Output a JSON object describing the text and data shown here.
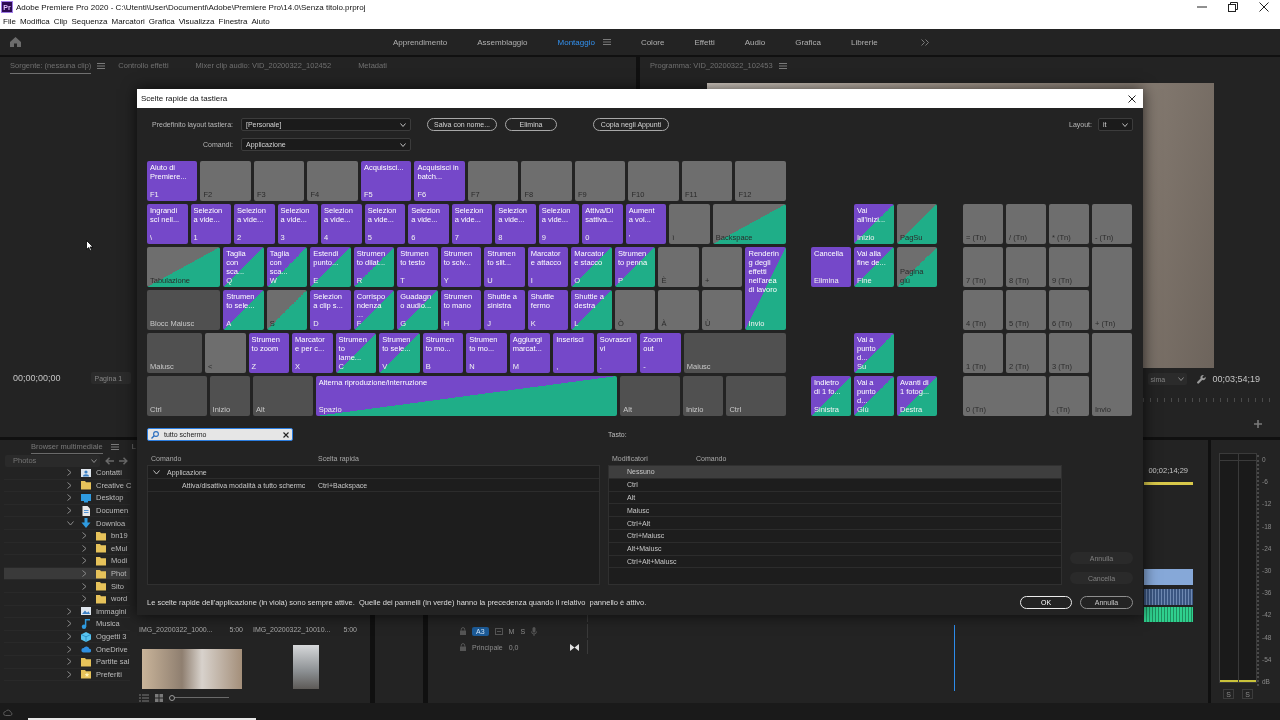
{
  "window": {
    "app_icon": "Pr",
    "title": "Adobe Premiere Pro 2020 - C:\\Utenti\\User\\Documenti\\Adobe\\Premiere Pro\\14.0\\Senza titolo.prproj"
  },
  "menu": [
    "File",
    "Modifica",
    "Clip",
    "Sequenza",
    "Marcatori",
    "Grafica",
    "Visualizza",
    "Finestra",
    "Aiuto"
  ],
  "workspaces": [
    {
      "label": "Apprendimento",
      "selected": false
    },
    {
      "label": "Assemblaggio",
      "selected": false
    },
    {
      "label": "Montaggio",
      "selected": true
    },
    {
      "label": "Colore",
      "selected": false
    },
    {
      "label": "Effetti",
      "selected": false
    },
    {
      "label": "Audio",
      "selected": false
    },
    {
      "label": "Grafica",
      "selected": false
    },
    {
      "label": "Librerie",
      "selected": false
    }
  ],
  "source_panel": {
    "tabs": [
      {
        "label": "Sorgente: (nessuna clip)",
        "selected": true
      },
      {
        "label": "Controllo effetti",
        "selected": false
      },
      {
        "label": "Mixer clip audio: VID_20200322_102452",
        "selected": false
      },
      {
        "label": "Metadati",
        "selected": false
      }
    ],
    "timecode": "00;00;00;00",
    "page": "Pagina 1"
  },
  "program_panel": {
    "tabs": [
      {
        "label": "Programma: VID_20200322_102453",
        "selected": false
      }
    ],
    "resolution": "sima",
    "timecode": "00;03;54;19"
  },
  "media_browser": {
    "tabs": [
      {
        "label": "Browser multimediale",
        "selected": true
      },
      {
        "label": "L",
        "selected": false
      }
    ],
    "location": "Photos",
    "tree": [
      {
        "label": "Contatti",
        "kind": "contacts",
        "expanded": false,
        "selected": false
      },
      {
        "label": "Creative C",
        "kind": "folder",
        "expanded": false,
        "selected": false
      },
      {
        "label": "Desktop",
        "kind": "desktop",
        "expanded": false,
        "selected": false
      },
      {
        "label": "Documen",
        "kind": "document",
        "expanded": false,
        "selected": false
      },
      {
        "label": "Downloa",
        "kind": "download",
        "expanded": true,
        "selected": false,
        "children": [
          {
            "label": "bn19",
            "kind": "folder",
            "expanded": false,
            "selected": false
          },
          {
            "label": "eMul",
            "kind": "folder",
            "expanded": false,
            "selected": false
          },
          {
            "label": "Modi",
            "kind": "folder",
            "expanded": false,
            "selected": false
          },
          {
            "label": "Phot",
            "kind": "folder",
            "expanded": false,
            "selected": true
          },
          {
            "label": "Sito",
            "kind": "folder",
            "expanded": false,
            "selected": false
          },
          {
            "label": "word",
            "kind": "folder",
            "expanded": false,
            "selected": false
          }
        ]
      },
      {
        "label": "Immagini",
        "kind": "images",
        "expanded": false,
        "selected": false
      },
      {
        "label": "Musica",
        "kind": "music",
        "expanded": false,
        "selected": false
      },
      {
        "label": "Oggetti 3",
        "kind": "objects",
        "expanded": false,
        "selected": false
      },
      {
        "label": "OneDrive",
        "kind": "cloud",
        "expanded": false,
        "selected": false
      },
      {
        "label": "Partite sal",
        "kind": "folder",
        "expanded": false,
        "selected": false
      },
      {
        "label": "Preferiti",
        "kind": "favorites",
        "expanded": false,
        "selected": false
      }
    ],
    "thumbnails": [
      {
        "name": "IMG_20200322_1000...",
        "duration": "5:00"
      },
      {
        "name": "IMG_20200322_10010...",
        "duration": "5:00"
      }
    ],
    "thumbnail_zoom": {
      "level": 0
    }
  },
  "timeline": {
    "ruler_timecode": "00;02;14;29",
    "track_target": "A3",
    "mute": "M",
    "solo": "S",
    "mix_track": "Principale",
    "mix_volume": "0,0"
  },
  "audio_meter": {
    "scale": [
      "0",
      "-6",
      "-12",
      "-18",
      "-24",
      "-30",
      "-36",
      "-42",
      "-48",
      "-54",
      "dB"
    ],
    "solo_buttons": [
      "S",
      "S"
    ]
  },
  "dialog": {
    "title": "Scelte rapide da tastiera",
    "preset": {
      "label": "Predefinito layout tastiera:",
      "value": "[Personale]"
    },
    "preset_buttons": [
      "Salva con nome...",
      "Elimina",
      "Copia negli Appunti"
    ],
    "layout": {
      "label": "Layout:",
      "value": "it"
    },
    "commands": {
      "label": "Comandi:",
      "value": "Applicazione"
    },
    "keyboard": {
      "main_keys": [
        {
          "key": "F1",
          "command": "Aiuto di\nPremiere...",
          "kind": "app"
        },
        {
          "key": "F2",
          "kind": "free"
        },
        {
          "key": "F3",
          "kind": "free"
        },
        {
          "key": "F4",
          "kind": "free"
        },
        {
          "key": "F5",
          "command": "Acquisisci...",
          "kind": "app"
        },
        {
          "key": "F6",
          "command": "Acquisisci in\nbatch...",
          "kind": "app"
        },
        {
          "key": "F7",
          "kind": "free"
        },
        {
          "key": "F8",
          "kind": "free"
        },
        {
          "key": "F9",
          "kind": "free"
        },
        {
          "key": "F10",
          "kind": "free"
        },
        {
          "key": "F11",
          "kind": "free"
        },
        {
          "key": "F12",
          "kind": "free"
        },
        {
          "key": "\\",
          "command": "Ingrandi\nsci nell...",
          "kind": "app"
        },
        {
          "key": "1",
          "command": "Selezion\na vide...",
          "kind": "app"
        },
        {
          "key": "2",
          "command": "Selezion\na vide...",
          "kind": "app"
        },
        {
          "key": "3",
          "command": "Selezion\na vide...",
          "kind": "app"
        },
        {
          "key": "4",
          "command": "Selezion\na vide...",
          "kind": "app"
        },
        {
          "key": "5",
          "command": "Selezion\na vide...",
          "kind": "app"
        },
        {
          "key": "6",
          "command": "Selezion\na vide...",
          "kind": "app"
        },
        {
          "key": "7",
          "command": "Selezion\na vide...",
          "kind": "app"
        },
        {
          "key": "8",
          "command": "Selezion\na vide...",
          "kind": "app"
        },
        {
          "key": "9",
          "command": "Selezion\na vide...",
          "kind": "app"
        },
        {
          "key": "0",
          "command": "Attiva/Di\nsattiva...",
          "kind": "app"
        },
        {
          "key": "'",
          "command": "Aument\na vol...",
          "kind": "app"
        },
        {
          "key": "ì",
          "kind": "free"
        },
        {
          "key": "Backspace",
          "kind": "panel"
        },
        {
          "key": "Tabulazione",
          "kind": "panel"
        },
        {
          "key": "Q",
          "command": "Taglia\ncon\nsca...",
          "kind": "both"
        },
        {
          "key": "W",
          "command": "Taglia\ncon\nsca...",
          "kind": "both"
        },
        {
          "key": "E",
          "command": "Estendi\npunto...",
          "kind": "both"
        },
        {
          "key": "R",
          "command": "Strumen\nto dilat...",
          "kind": "both"
        },
        {
          "key": "T",
          "command": "Strumen\nto testo",
          "kind": "app"
        },
        {
          "key": "Y",
          "command": "Strumen\nto sciv...",
          "kind": "app"
        },
        {
          "key": "U",
          "command": "Strumen\nto slit...",
          "kind": "app"
        },
        {
          "key": "I",
          "command": "Marcator\ne attacco",
          "kind": "app"
        },
        {
          "key": "O",
          "command": "Marcator\ne stacco",
          "kind": "both"
        },
        {
          "key": "P",
          "command": "Strumen\nto penna",
          "kind": "both"
        },
        {
          "key": "È",
          "kind": "free"
        },
        {
          "key": "+",
          "kind": "free"
        },
        {
          "key": "Blocc Maiusc",
          "kind": "modifier"
        },
        {
          "key": "A",
          "command": "Strumen\nto sele...",
          "kind": "both"
        },
        {
          "key": "S",
          "kind": "panel"
        },
        {
          "key": "D",
          "command": "Selezion\na clip s...",
          "kind": "app"
        },
        {
          "key": "F",
          "command": "Corrispo\nndenza\n...",
          "kind": "both"
        },
        {
          "key": "G",
          "command": "Guadagn\no audio...",
          "kind": "both"
        },
        {
          "key": "H",
          "command": "Strumen\nto mano",
          "kind": "app"
        },
        {
          "key": "J",
          "command": "Shuttle a\nsinistra",
          "kind": "app"
        },
        {
          "key": "K",
          "command": "Shuttle\nfermo",
          "kind": "app"
        },
        {
          "key": "L",
          "command": "Shuttle a\ndestra",
          "kind": "both"
        },
        {
          "key": "Ò",
          "kind": "free"
        },
        {
          "key": "À",
          "kind": "free"
        },
        {
          "key": "Ù",
          "kind": "free"
        },
        {
          "key": "Invio",
          "command": "Renderin\ng degli\neffetti\nnell'area\ndi lavoro",
          "kind": "both"
        },
        {
          "key": "Maiusc",
          "kind": "modifier"
        },
        {
          "key": "<",
          "kind": "free"
        },
        {
          "key": "Z",
          "command": "Strumen\nto zoom",
          "kind": "app"
        },
        {
          "key": "X",
          "command": "Marcator\ne per c...",
          "kind": "app"
        },
        {
          "key": "C",
          "command": "Strumen\nto\nlame...",
          "kind": "both"
        },
        {
          "key": "V",
          "command": "Strumen\nto sele...",
          "kind": "both"
        },
        {
          "key": "B",
          "command": "Strumen\nto mo...",
          "kind": "app"
        },
        {
          "key": "N",
          "command": "Strumen\nto mo...",
          "kind": "app"
        },
        {
          "key": "M",
          "command": "Aggiungi\nmarcat...",
          "kind": "app"
        },
        {
          "key": ",",
          "command": "Inserisci",
          "kind": "app"
        },
        {
          "key": ".",
          "command": "Sovrascri\nvi",
          "kind": "app"
        },
        {
          "key": "-",
          "command": "Zoom\nout",
          "kind": "app"
        },
        {
          "key": "Maiusc",
          "kind": "modifier"
        },
        {
          "key": "Ctrl",
          "kind": "modifier"
        },
        {
          "key": "Inizio",
          "kind": "modifier"
        },
        {
          "key": "Alt",
          "kind": "modifier"
        },
        {
          "key": "Spazio",
          "command": "Alterna riproduzione/interruzione",
          "kind": "both"
        },
        {
          "key": "Alt",
          "kind": "modifier"
        },
        {
          "key": "Inizio",
          "kind": "modifier"
        },
        {
          "key": "Ctrl",
          "kind": "modifier"
        }
      ],
      "nav": [
        {
          "key": "Inizio",
          "command": "Vai\nall'inizi...",
          "kind": "both"
        },
        {
          "key": "PagSu",
          "kind": "panel"
        },
        {
          "key": "Elimina",
          "command": "Cancella",
          "kind": "app"
        },
        {
          "key": "Fine",
          "command": "Vai alla\nfine de...",
          "kind": "both"
        },
        {
          "key": "Pagina\ngiù",
          "kind": "panel"
        },
        {
          "key": "Su",
          "command": "Vai a\npunto\nd...",
          "kind": "both"
        },
        {
          "key": "Sinistra",
          "command": "Indietro\ndi 1 fo...",
          "kind": "both"
        },
        {
          "key": "Giù",
          "command": "Vai a\npunto\nd...",
          "kind": "both"
        },
        {
          "key": "Destra",
          "command": "Avanti di\n1 fotog...",
          "kind": "both"
        }
      ],
      "numpad": [
        {
          "key": "= (Tn)",
          "kind": "free"
        },
        {
          "key": "/ (Tn)",
          "kind": "free"
        },
        {
          "key": "* (Tn)",
          "kind": "free"
        },
        {
          "key": "- (Tn)",
          "kind": "free"
        },
        {
          "key": "7 (Tn)",
          "kind": "free"
        },
        {
          "key": "8 (Tn)",
          "kind": "free"
        },
        {
          "key": "9 (Tn)",
          "kind": "free"
        },
        {
          "key": "4 (Tn)",
          "kind": "free"
        },
        {
          "key": "5 (Tn)",
          "kind": "free"
        },
        {
          "key": "6 (Tn)",
          "kind": "free"
        },
        {
          "key": "+ (Tn)",
          "kind": "free"
        },
        {
          "key": "1 (Tn)",
          "kind": "free"
        },
        {
          "key": "2 (Tn)",
          "kind": "free"
        },
        {
          "key": "3 (Tn)",
          "kind": "free"
        },
        {
          "key": "0 (Tn)",
          "kind": "free"
        },
        {
          "key": ". (Tn)",
          "kind": "free"
        },
        {
          "key": "Invio",
          "kind": "free"
        }
      ]
    },
    "search": {
      "value": "tutto schermo"
    },
    "key_label": "Tasto:",
    "command_table": {
      "columns": [
        "Comando",
        "Scelta rapida"
      ],
      "groups": [
        {
          "label": "Applicazione",
          "expanded": true,
          "rows": [
            {
              "command": "Attiva/disattiva modalità a tutto schermc",
              "shortcut": "Ctrl+Backspace"
            }
          ]
        }
      ]
    },
    "modifier_table": {
      "columns": [
        "Modificatori",
        "Comando"
      ],
      "rows": [
        {
          "modifiers": "Nessuno",
          "selected": true
        },
        {
          "modifiers": "Ctrl",
          "selected": false
        },
        {
          "modifiers": "Alt",
          "selected": false
        },
        {
          "modifiers": "Maiusc",
          "selected": false
        },
        {
          "modifiers": "Ctrl+Alt",
          "selected": false
        },
        {
          "modifiers": "Ctrl+Maiusc",
          "selected": false
        },
        {
          "modifiers": "Alt+Maiusc",
          "selected": false
        },
        {
          "modifiers": "Ctrl+Alt+Maiusc",
          "selected": false
        }
      ]
    },
    "side_buttons": [
      {
        "label": "Annulla",
        "disabled": true
      },
      {
        "label": "Cancella",
        "disabled": true
      }
    ],
    "note": "Le scelte rapide dell'applicazione (in viola) sono sempre attive.  Quelle dei pannelli (in verde) hanno la precedenza quando il relativo  pannello è attivo.",
    "buttons": [
      {
        "label": "OK",
        "default": true
      },
      {
        "label": "Annulla",
        "default": false
      }
    ]
  }
}
